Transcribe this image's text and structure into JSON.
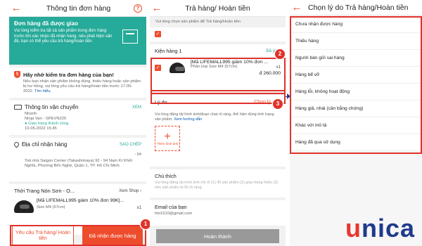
{
  "screen1": {
    "title": "Thông tin đơn hàng",
    "banner_title": "Đơn hàng đã được giao",
    "banner_text": "Vui lòng kiểm tra tất cả sản phẩm trong đơn hàng trước khi xác nhận đã nhận hàng, nếu phát hiện vấn đề, bạn có thể yêu cầu trả hàng/hoàn tiền",
    "check_title": "Hãy nhớ kiểm tra đơn hàng của bạn!",
    "check_text": "Nếu bạn nhận sản phẩm không đúng, thiếu hàng hoặc sản phẩm bị hư hỏng, vui lòng yêu cầu trả hàng/hoàn tiền trước 17-05-2022.",
    "check_link": "Tìm hiểu",
    "ship_title": "Thông tin vận chuyển",
    "ship_link": "XEM",
    "ship_carrier": "Nhanh",
    "ship_code": "Ninja Van - SPEVN225",
    "ship_status": "Giao hàng thành công",
    "ship_time": "10-05-2022 15:45",
    "addr_title": "Địa chỉ nhận hàng",
    "addr_link": "SAO CHÉP",
    "addr_line1": "- 94",
    "addr_line2": "Toà nhà Saigon Center (Takashimaya) 92 - 94 Nam Kì Khởi Nghĩa, Phường Bến Nghé, Quận 1, TP. Hồ Chí Minh",
    "shop_name": "Thời Trang Nón Sơn - O...",
    "shop_link": "Xem Shop",
    "product_name": "[Mã LIFEMALL995 giảm 10% đơn 99K]...",
    "product_variant": "Size M4 (57cm)",
    "product_qty": "x1",
    "btn_return": "Yêu cầu Trả hàng/ Hoàn tiền",
    "btn_received": "Đã nhận được hàng",
    "badge": "1"
  },
  "screen2": {
    "title": "Trả hàng/ Hoàn tiền",
    "instruction": "Vui lòng chọn sản phẩm để Trả hàng/Hoàn tiền",
    "package_label": "Kiện hàng 1",
    "package_status": "Đã giao",
    "product_name": "[Mã LIFEMALL995 giảm 10% đơn ...",
    "product_variant": "Phân loại Size M4 (57cm)",
    "product_qty": "x1",
    "product_price": "đ 260.000",
    "reason_label": "Lý do",
    "reason_value": "Chọn lý do",
    "reason_note": "Vui lòng đăng tải hình ảnh/đoạn chat rõ ràng, thể hiện đúng tình trạng sản phẩm.",
    "reason_note_link": "Xem hướng dẫn",
    "upload_label": "Thêm hình ảnh",
    "note_label": "Chú thích",
    "note_placeholder": "Vui lòng đăng tải hình ảnh chi rõ (1) lỗi sản phẩm (2) giao hàng thiếu (3) nếu sản phẩm bị lỗi rõ ràng",
    "email_label": "Email của bạn",
    "email_value": "hto1910@gmail.com",
    "btn_done": "Hoàn thành",
    "badge2": "2",
    "badge3": "3"
  },
  "screen3": {
    "title": "Chọn lý do Trả hàng/Hoàn tiền",
    "reasons": [
      "Chưa nhận được hàng",
      "Thiếu hàng",
      "Người bán gửi sai hàng",
      "Hàng bể vỡ",
      "Hàng lỗi, không hoạt động",
      "Hàng giả, nhái (cần bằng chứng)",
      "Khác với mô tả",
      "Hàng đã qua sử dụng"
    ]
  },
  "logo": {
    "u": "u",
    "rest": "nica"
  },
  "colors": {
    "accent": "#ee4d2d",
    "teal": "#26aa99",
    "highlight": "#e0322b",
    "logo_blue": "#1e3a8c"
  }
}
